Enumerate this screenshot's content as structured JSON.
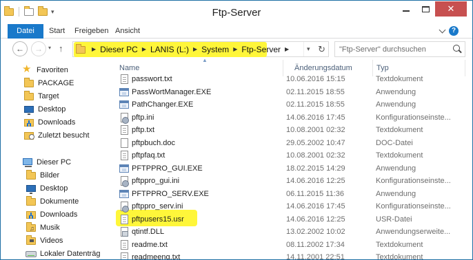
{
  "window": {
    "title": "Ftp-Server",
    "close_glyph": "✕"
  },
  "ribbon": {
    "tabs": [
      "Datei",
      "Start",
      "Freigeben",
      "Ansicht"
    ]
  },
  "address": {
    "crumbs": [
      "Dieser PC",
      "LANIS (L:)",
      "System",
      "Ftp-Server"
    ]
  },
  "search": {
    "placeholder": "\"Ftp-Server\" durchsuchen"
  },
  "nav_pane": {
    "favorites": {
      "label": "Favoriten",
      "items": [
        "PACKAGE",
        "Target",
        "Desktop",
        "Downloads",
        "Zuletzt besucht"
      ]
    },
    "this_pc": {
      "label": "Dieser PC",
      "items": [
        "Bilder",
        "Desktop",
        "Dokumente",
        "Downloads",
        "Musik",
        "Videos",
        "Lokaler Datenträg"
      ]
    }
  },
  "columns": {
    "name": "Name",
    "date": "Änderungsdatum",
    "type": "Typ"
  },
  "files": [
    {
      "name": "passwort.txt",
      "date": "10.06.2016 15:15",
      "type": "Textdokument",
      "icon": "txt"
    },
    {
      "name": "PassWortManager.EXE",
      "date": "02.11.2015 18:55",
      "type": "Anwendung",
      "icon": "exe"
    },
    {
      "name": "PathChanger.EXE",
      "date": "02.11.2015 18:55",
      "type": "Anwendung",
      "icon": "exe"
    },
    {
      "name": "pftp.ini",
      "date": "14.06.2016 17:45",
      "type": "Konfigurationseinste...",
      "icon": "ini"
    },
    {
      "name": "pftp.txt",
      "date": "10.08.2001 02:32",
      "type": "Textdokument",
      "icon": "txt"
    },
    {
      "name": "pftpbuch.doc",
      "date": "29.05.2002 10:47",
      "type": "DOC-Datei",
      "icon": "doc"
    },
    {
      "name": "pftpfaq.txt",
      "date": "10.08.2001 02:32",
      "type": "Textdokument",
      "icon": "txt"
    },
    {
      "name": "PFTPPRO_GUI.EXE",
      "date": "18.02.2015 14:29",
      "type": "Anwendung",
      "icon": "exe"
    },
    {
      "name": "pftppro_gui.ini",
      "date": "14.06.2016 12:25",
      "type": "Konfigurationseinste...",
      "icon": "ini"
    },
    {
      "name": "PFTPPRO_SERV.EXE",
      "date": "06.11.2015 11:36",
      "type": "Anwendung",
      "icon": "exe"
    },
    {
      "name": "pftppro_serv.ini",
      "date": "14.06.2016 17:45",
      "type": "Konfigurationseinste...",
      "icon": "ini"
    },
    {
      "name": "pftpusers15.usr",
      "date": "14.06.2016 12:25",
      "type": "USR-Datei",
      "icon": "txt"
    },
    {
      "name": "qtintf.DLL",
      "date": "13.02.2002 10:02",
      "type": "Anwendungserweite...",
      "icon": "dll"
    },
    {
      "name": "readme.txt",
      "date": "08.11.2002 17:34",
      "type": "Textdokument",
      "icon": "txt"
    },
    {
      "name": "readmeeng.txt",
      "date": "14.11.2001 22:51",
      "type": "Textdokument",
      "icon": "txt"
    }
  ]
}
